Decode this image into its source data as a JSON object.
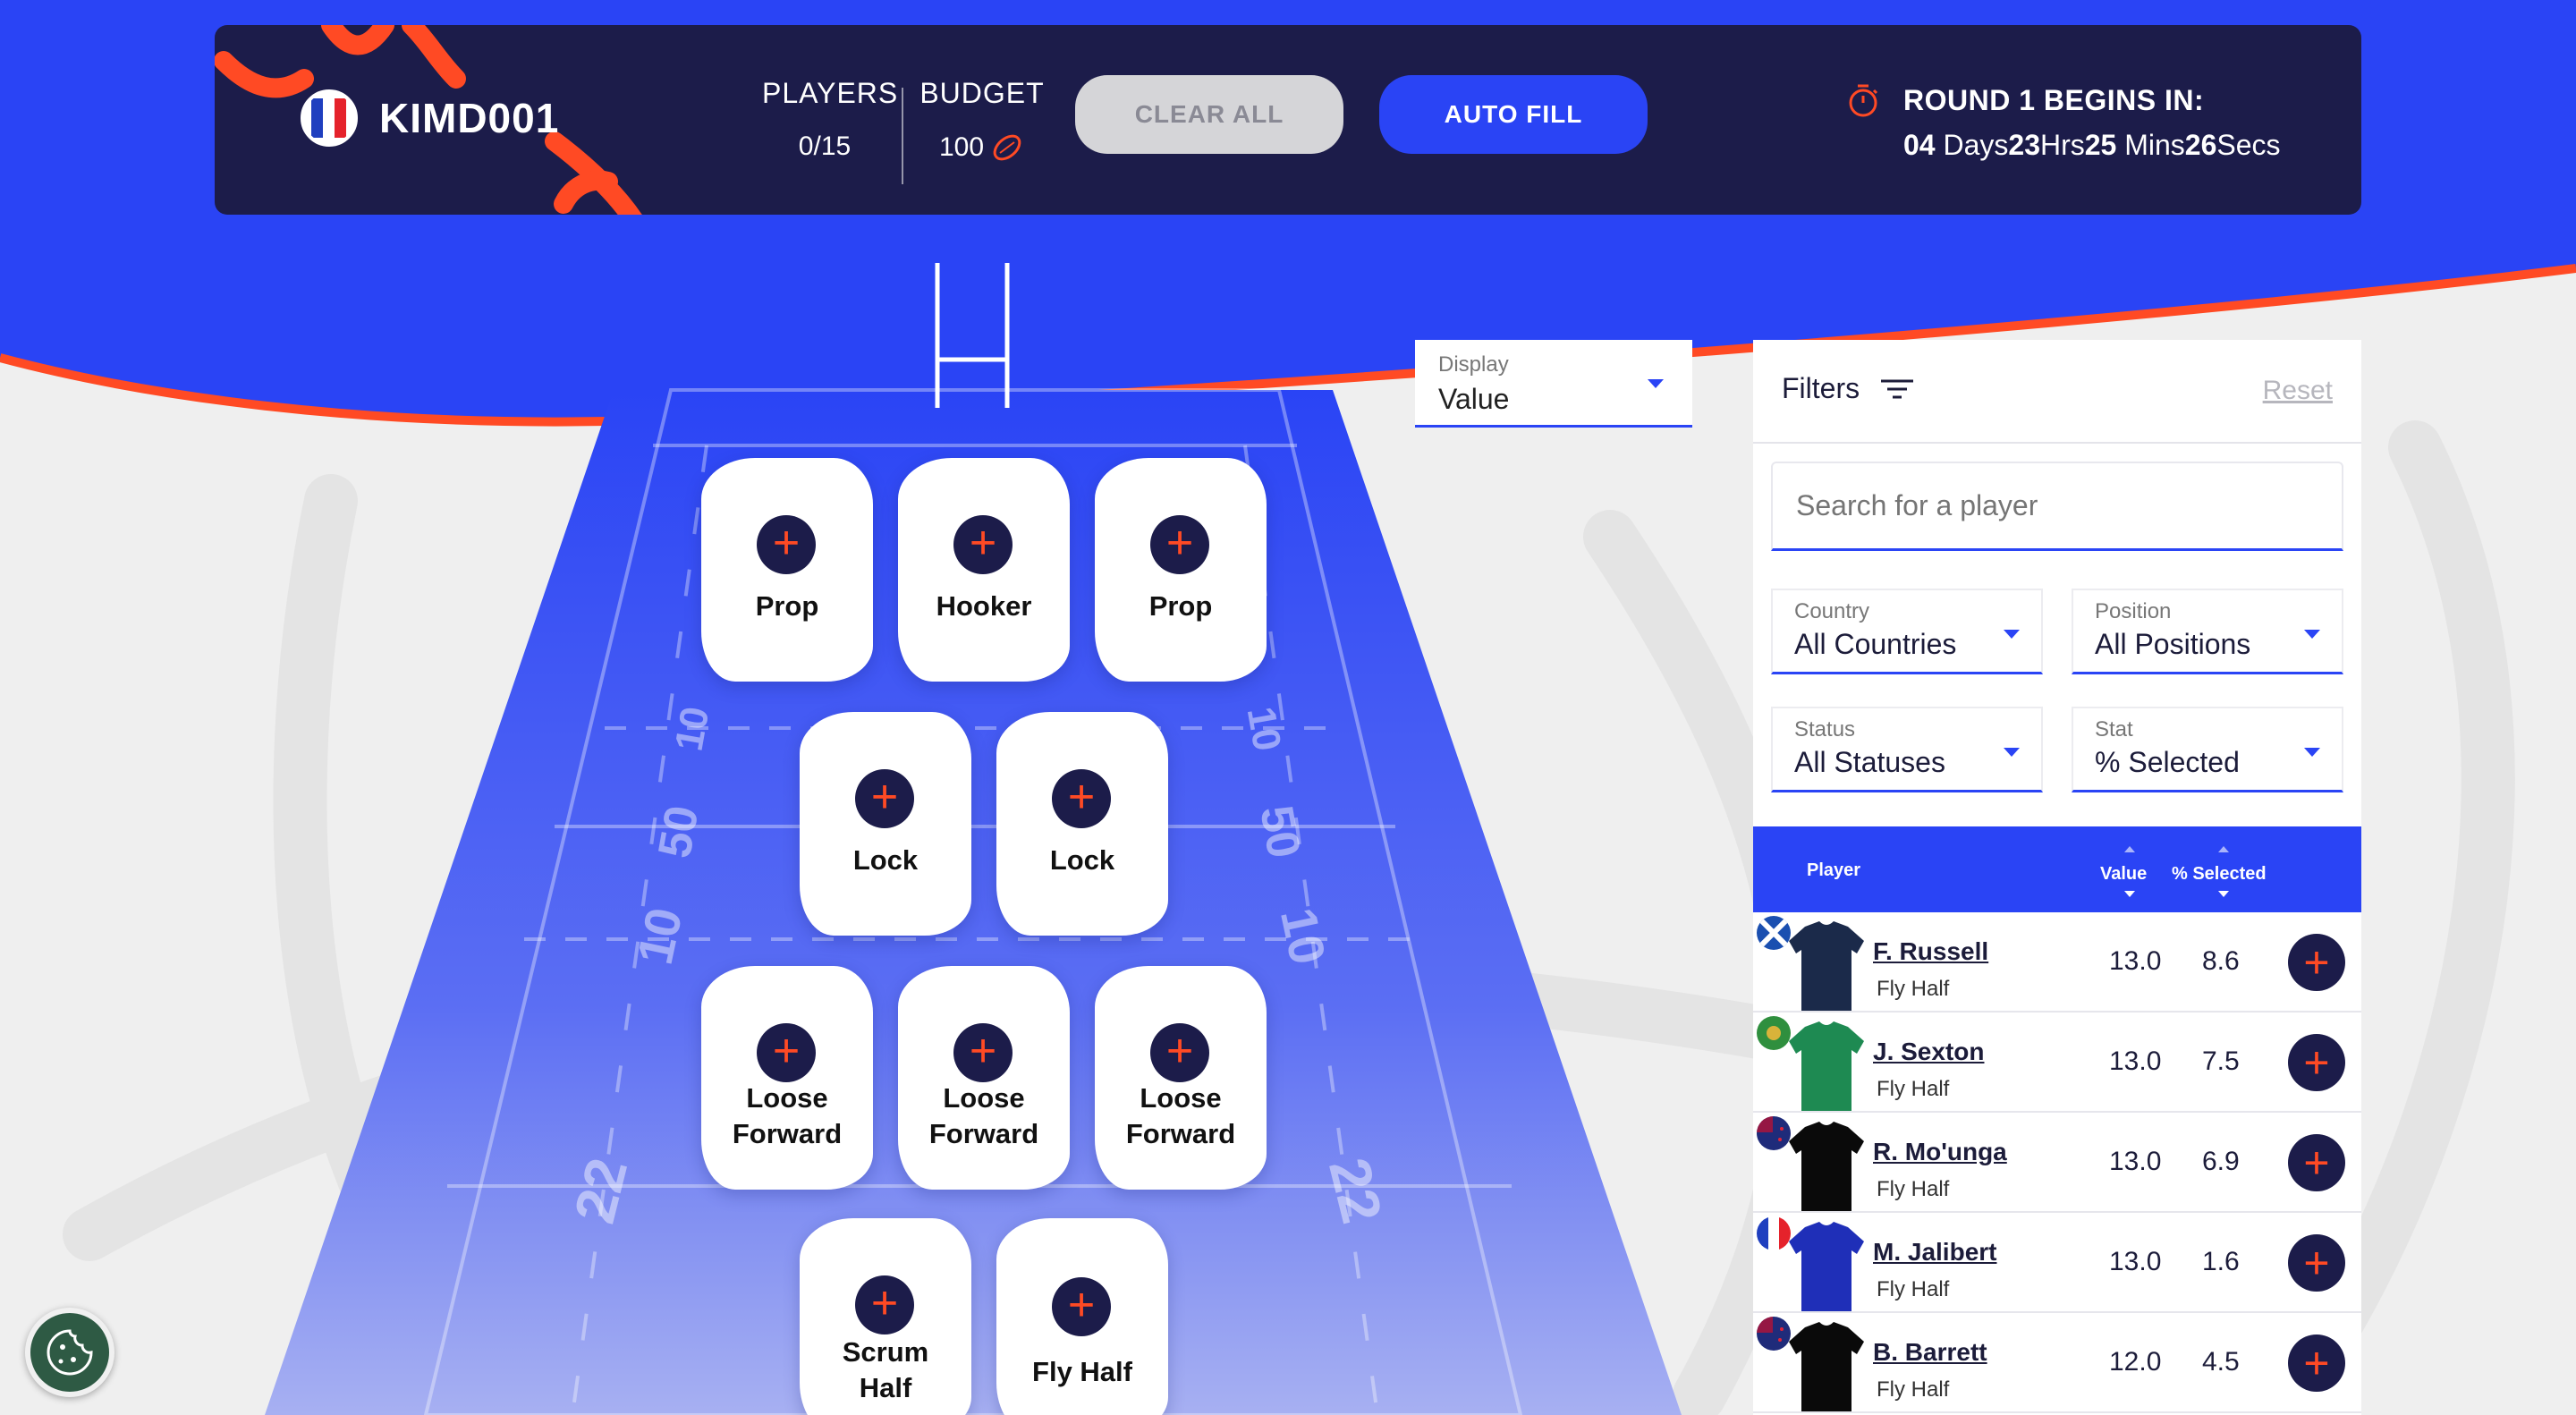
{
  "header": {
    "team_name": "KIMD001",
    "players_label": "PLAYERS",
    "players_value": "0/15",
    "budget_label": "BUDGET",
    "budget_value": "100",
    "clear_all_label": "CLEAR ALL",
    "auto_fill_label": "AUTO FILL",
    "round_title": "ROUND 1 BEGINS IN:",
    "countdown": {
      "days_value": "04",
      "days_unit": "Days",
      "hours_value": "23",
      "hours_unit": "Hrs",
      "mins_value": "25",
      "mins_unit": "Mins",
      "secs_value": "26",
      "secs_unit": "Secs"
    }
  },
  "pitch": {
    "positions": [
      {
        "label": "Prop"
      },
      {
        "label": "Hooker"
      },
      {
        "label": "Prop"
      },
      {
        "label": "Lock"
      },
      {
        "label": "Lock"
      },
      {
        "label": "Loose Forward"
      },
      {
        "label": "Loose Forward"
      },
      {
        "label": "Loose Forward"
      },
      {
        "label": "Scrum Half"
      },
      {
        "label": "Fly Half"
      }
    ],
    "line_markers": [
      "10",
      "10",
      "50",
      "50",
      "10",
      "10",
      "22",
      "22"
    ]
  },
  "display": {
    "label": "Display",
    "value": "Value"
  },
  "filters": {
    "title": "Filters",
    "reset_label": "Reset",
    "search_placeholder": "Search for a player",
    "country": {
      "label": "Country",
      "value": "All Countries"
    },
    "position": {
      "label": "Position",
      "value": "All Positions"
    },
    "status": {
      "label": "Status",
      "value": "All Statuses"
    },
    "stat": {
      "label": "Stat",
      "value": "% Selected"
    }
  },
  "table": {
    "col_player": "Player",
    "col_value": "Value",
    "col_selected": "% Selected",
    "rows": [
      {
        "name": "F. Russell",
        "position": "Fly Half",
        "value": "13.0",
        "selected": "8.6",
        "country": "Scotland",
        "shirt_color": "#1b2a4a"
      },
      {
        "name": "J. Sexton",
        "position": "Fly Half",
        "value": "13.0",
        "selected": "7.5",
        "country": "Ireland",
        "shirt_color": "#1e8a52"
      },
      {
        "name": "R. Mo'unga",
        "position": "Fly Half",
        "value": "13.0",
        "selected": "6.9",
        "country": "New Zealand",
        "shirt_color": "#0a0a0a"
      },
      {
        "name": "M. Jalibert",
        "position": "Fly Half",
        "value": "13.0",
        "selected": "1.6",
        "country": "France",
        "shirt_color": "#1f2fb8"
      },
      {
        "name": "B. Barrett",
        "position": "Fly Half",
        "value": "12.0",
        "selected": "4.5",
        "country": "New Zealand",
        "shirt_color": "#0a0a0a"
      }
    ]
  },
  "colors": {
    "navy": "#1c1c4a",
    "brand_blue": "#2a44f5",
    "accent_red": "#ff4a24"
  }
}
